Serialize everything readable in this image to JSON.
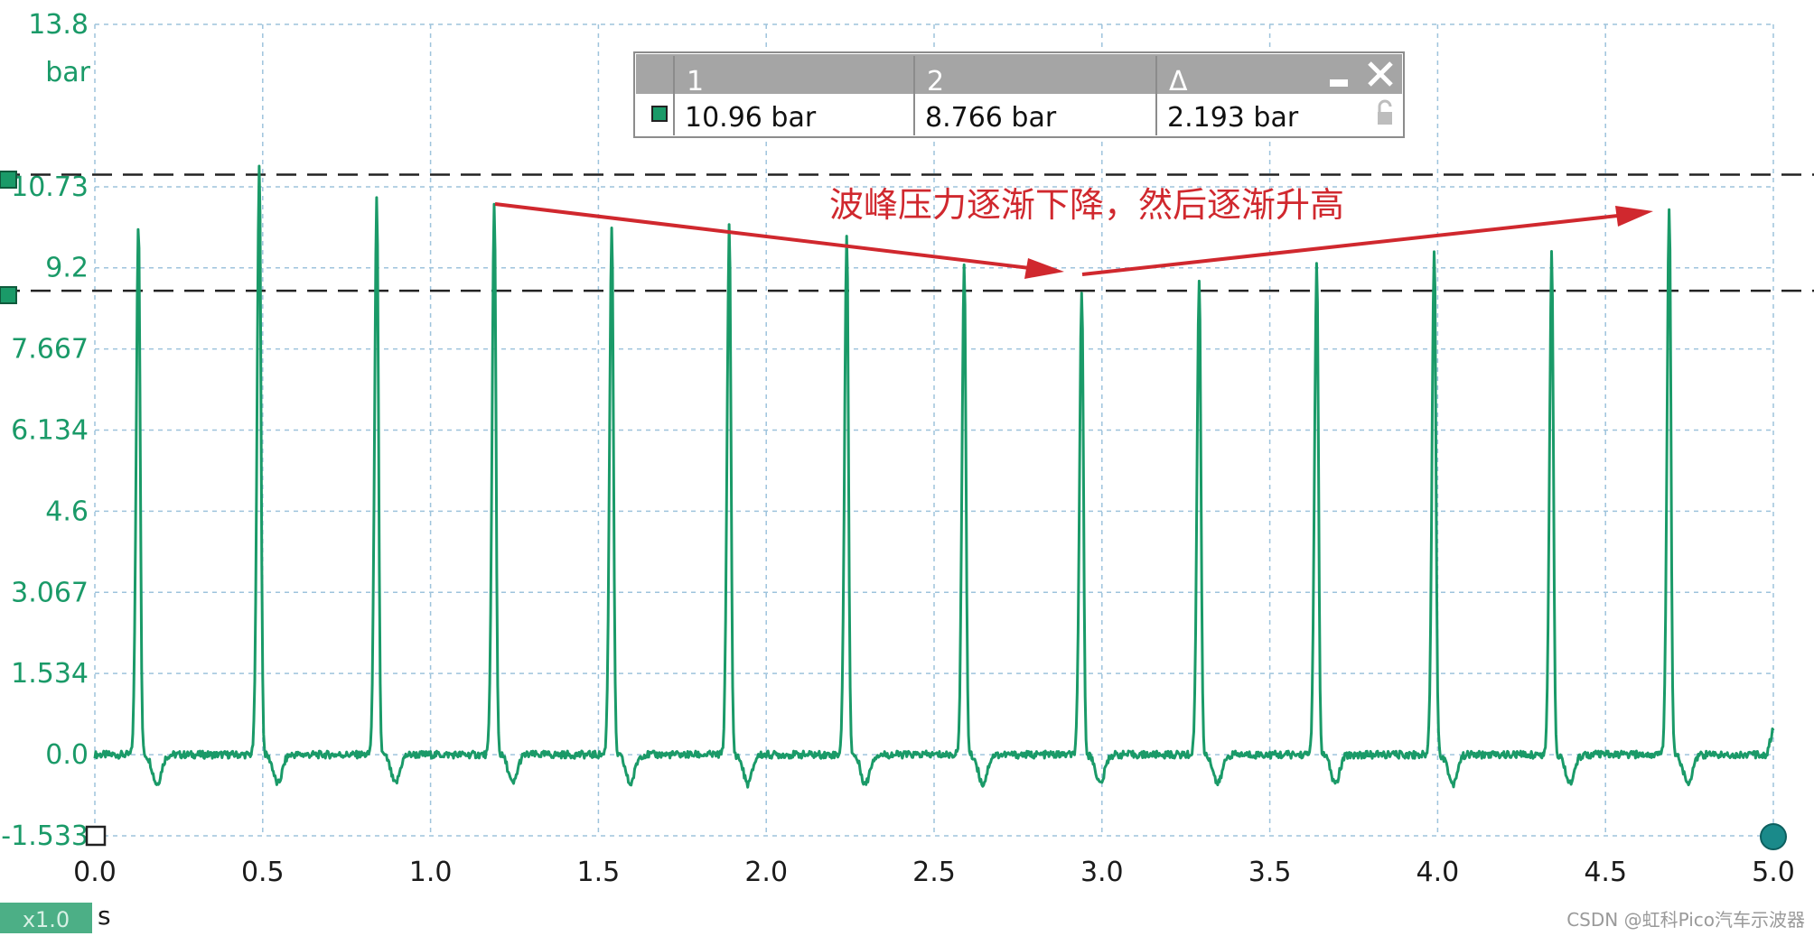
{
  "colors": {
    "trace": "#1a9a68",
    "grid": "#9ec3dc",
    "cursor_line": "#222222",
    "annotation": "#d0282e",
    "panel_header": "#a5a5a5",
    "zoom_badge": "#4caf86"
  },
  "zoom_badge": "x1.0",
  "watermark": "CSDN @虹科Pico汽车示波器",
  "annotation": {
    "text": "波峰压力逐渐下降，然后逐渐升高"
  },
  "readout": {
    "headers": [
      "1",
      "2",
      "Δ"
    ],
    "values": [
      "10.96 bar",
      "8.766 bar",
      "2.193 bar"
    ],
    "minimize_icon": "minimize-icon",
    "close_icon": "close-icon",
    "lock_icon": "lock-icon"
  },
  "cursors": [
    {
      "name": "cursor-1",
      "value": 10.96
    },
    {
      "name": "cursor-2",
      "value": 8.766
    }
  ],
  "chart_data": {
    "type": "line",
    "title": "",
    "xlabel": "s",
    "ylabel": "bar",
    "xlim": [
      0.0,
      5.0
    ],
    "ylim": [
      -1.533,
      13.8
    ],
    "grid": true,
    "x_ticks": [
      "0.0",
      "0.5",
      "1.0",
      "1.5",
      "2.0",
      "2.5",
      "3.0",
      "3.5",
      "4.0",
      "4.5",
      "5.0"
    ],
    "y_ticks": [
      {
        "label": "13.8",
        "value": 13.8
      },
      {
        "label": "10.73",
        "value": 10.73
      },
      {
        "label": "9.2",
        "value": 9.2
      },
      {
        "label": "7.667",
        "value": 7.667
      },
      {
        "label": "6.134",
        "value": 6.134
      },
      {
        "label": "4.6",
        "value": 4.6
      },
      {
        "label": "3.067",
        "value": 3.067
      },
      {
        "label": "1.534",
        "value": 1.534
      },
      {
        "label": "0.0",
        "value": 0.0
      },
      {
        "label": "-1.533",
        "value": -1.533
      }
    ],
    "series": [
      {
        "baseline": 0.0,
        "peaks": [
          {
            "x": 0.13,
            "y": 10.1
          },
          {
            "x": 0.49,
            "y": 11.1
          },
          {
            "x": 0.84,
            "y": 10.5
          },
          {
            "x": 1.19,
            "y": 10.4
          },
          {
            "x": 1.54,
            "y": 10.0
          },
          {
            "x": 1.89,
            "y": 10.0
          },
          {
            "x": 2.24,
            "y": 9.8
          },
          {
            "x": 2.59,
            "y": 9.3
          },
          {
            "x": 2.94,
            "y": 8.8
          },
          {
            "x": 3.29,
            "y": 9.0
          },
          {
            "x": 3.64,
            "y": 9.3
          },
          {
            "x": 3.99,
            "y": 9.6
          },
          {
            "x": 4.34,
            "y": 9.5
          },
          {
            "x": 4.69,
            "y": 10.4
          }
        ]
      }
    ]
  }
}
